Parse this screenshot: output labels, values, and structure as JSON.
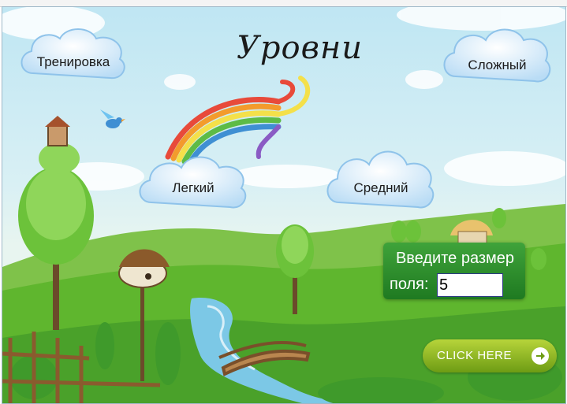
{
  "title": "Уровни",
  "levels": {
    "training": "Тренировка",
    "easy": "Легкий",
    "medium": "Средний",
    "hard": "Сложный"
  },
  "field_size": {
    "prompt_line1": "Введите размер",
    "prompt_line2": "поля:",
    "value": "5"
  },
  "start_button": {
    "label": "CLICK HERE",
    "icon": "arrow-right-icon"
  },
  "colors": {
    "sky": "#bfe6f3",
    "grass": "#5fb62e",
    "input_panel": "#2f8f2c",
    "button": "#9cc22a"
  }
}
